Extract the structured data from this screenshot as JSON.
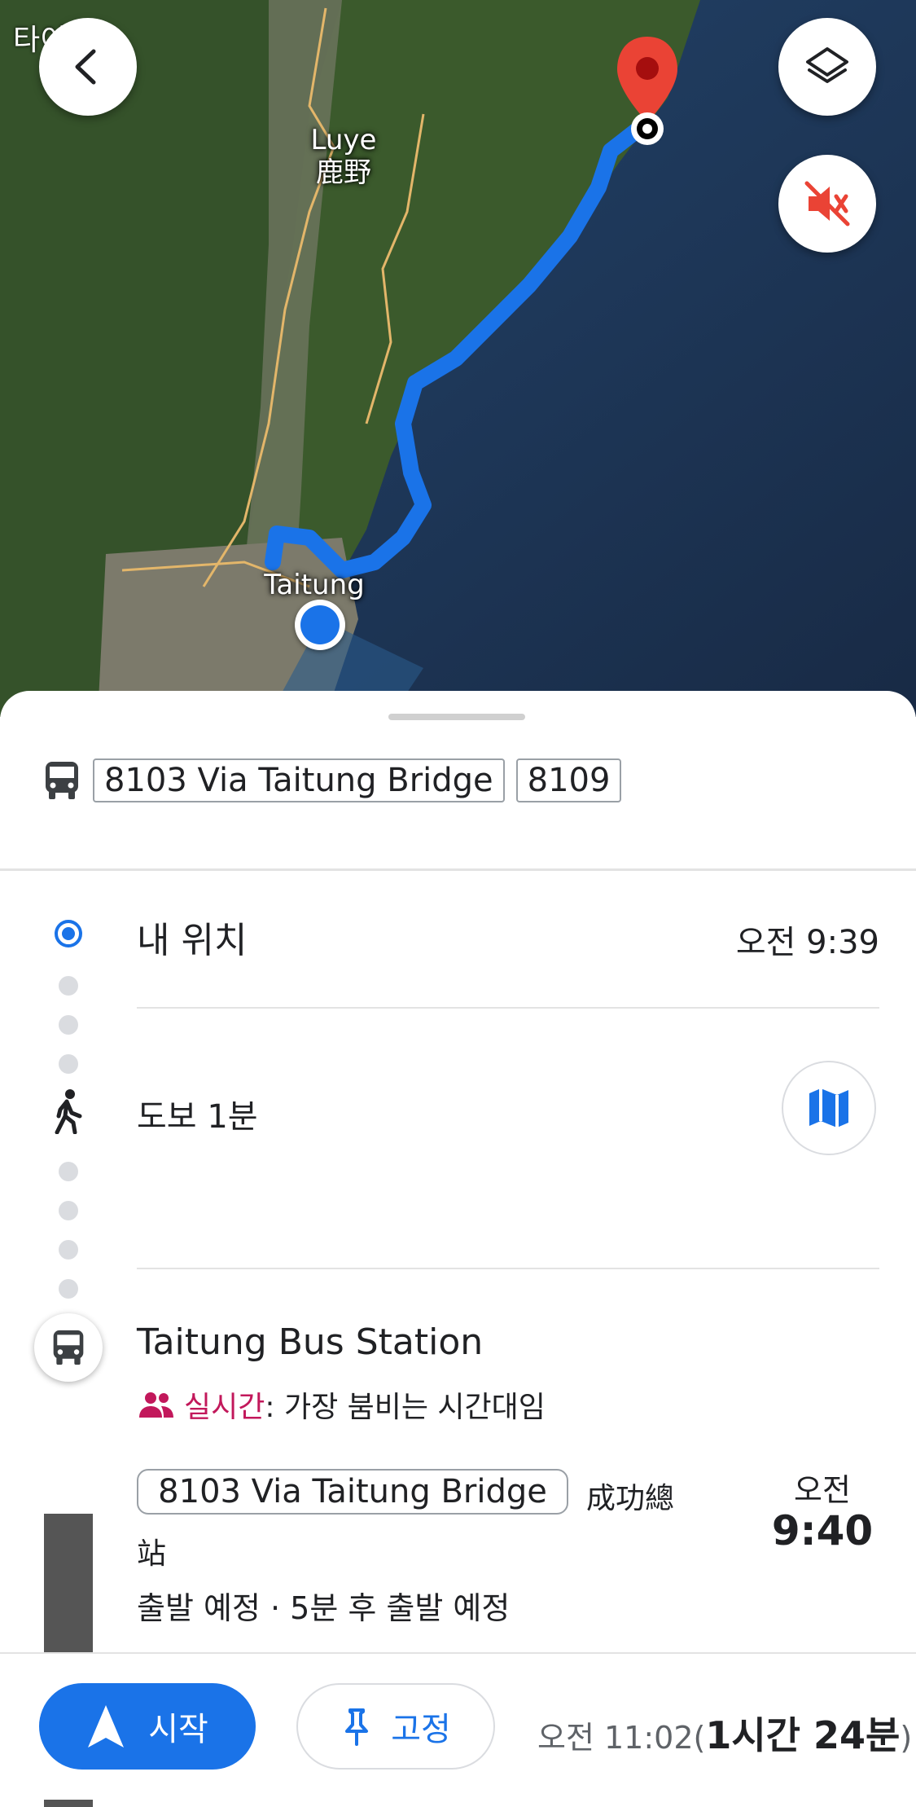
{
  "map": {
    "corner_label": "타이동",
    "labels": {
      "luye_en": "Luye",
      "luye_zh": "鹿野",
      "taitung": "Taitung"
    }
  },
  "route_summary": {
    "chips": [
      "8103 Via Taitung Bridge",
      "8109"
    ]
  },
  "steps": {
    "origin": {
      "label": "내 위치",
      "time": "오전 9:39"
    },
    "walk": {
      "label": "도보 1분"
    },
    "station": {
      "name": "Taitung Bus Station",
      "crowd_live": "실시간",
      "crowd_text": ": 가장 붐비는 시간대임",
      "route_chip": "8103 Via Taitung Bridge",
      "destination_part1": "成功總",
      "destination_part2": "站",
      "departure_info": "출발 예정 · 5분 후 출발 예정",
      "dep_ampm": "오전",
      "dep_time": "9:40"
    }
  },
  "bottom_bar": {
    "start_label": "시작",
    "pin_label": "고정",
    "eta_time": "오전 11:02",
    "eta_open": "(",
    "eta_duration": "1시간 24분",
    "eta_close": ")"
  },
  "colors": {
    "accent": "#1a73e8",
    "route_line": "#1a73e8",
    "live_pink": "#c2185b",
    "pin_red": "#ea4335"
  }
}
